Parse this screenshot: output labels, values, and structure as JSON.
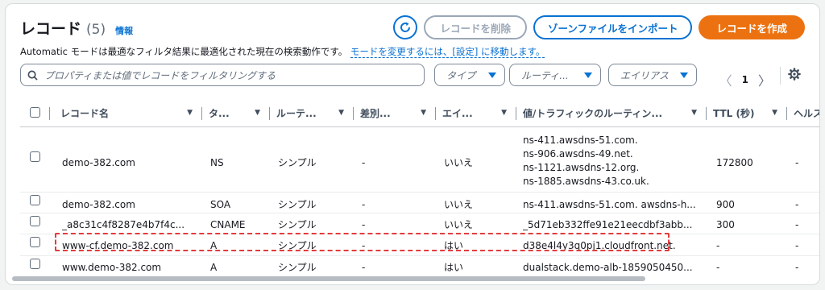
{
  "header": {
    "title": "レコード",
    "count": "(5)",
    "info": "情報"
  },
  "description": {
    "text": "Automatic モードは最適なフィルタ結果に最適化された現在の検索動作です。",
    "link": "モードを変更するには、[設定] に移動します。"
  },
  "toolbar": {
    "delete_label": "レコードを削除",
    "import_label": "ゾーンファイルをインポート",
    "create_label": "レコードを作成"
  },
  "filters": {
    "search_placeholder": "プロパティまたは値でレコードをフィルタリングする",
    "type_label": "タイプ",
    "routing_label": "ルーティ...",
    "alias_label": "エイリアス"
  },
  "pagination": {
    "page": "1",
    "prev": "〈",
    "next": "〉"
  },
  "columns": [
    "レコード名",
    "タ...",
    "ルーテ...",
    "差別...",
    "エイ...",
    "値/トラフィックのルーティン...",
    "TTL (秒)",
    "ヘルス"
  ],
  "rows": [
    {
      "name": "demo-382.com",
      "type": "NS",
      "routing": "シンプル",
      "diff": "-",
      "alias": "いいえ",
      "value": [
        "ns-411.awsdns-51.com.",
        "ns-906.awsdns-49.net.",
        "ns-1121.awsdns-12.org.",
        "ns-1885.awsdns-43.co.uk."
      ],
      "ttl": "172800",
      "health": "-"
    },
    {
      "name": "demo-382.com",
      "type": "SOA",
      "routing": "シンプル",
      "diff": "-",
      "alias": "いいえ",
      "value": [
        "ns-411.awsdns-51.com. awsdns-h..."
      ],
      "ttl": "900",
      "health": "-"
    },
    {
      "name": "_a8c31c4f8287e4b7f4c...",
      "type": "CNAME",
      "routing": "シンプル",
      "diff": "-",
      "alias": "いいえ",
      "value": [
        "_5d71eb332ffe91e21eecdbf3abb..."
      ],
      "ttl": "300",
      "health": "-"
    },
    {
      "name": "www-cf.demo-382.com",
      "type": "A",
      "routing": "シンプル",
      "diff": "-",
      "alias": "はい",
      "value": [
        "d38e4l4y3q0pj1.cloudfront.net."
      ],
      "ttl": "-",
      "health": "-"
    },
    {
      "name": "www.demo-382.com",
      "type": "A",
      "routing": "シンプル",
      "diff": "-",
      "alias": "はい",
      "value": [
        "dualstack.demo-alb-1859050450..."
      ],
      "ttl": "-",
      "health": "-"
    }
  ],
  "colors": {
    "link": "#0972d3",
    "primary": "#ec7211",
    "highlight": "#e23c3c"
  },
  "icons": {
    "refresh": "refresh-icon",
    "search": "search-icon",
    "settings": "gear-icon"
  }
}
